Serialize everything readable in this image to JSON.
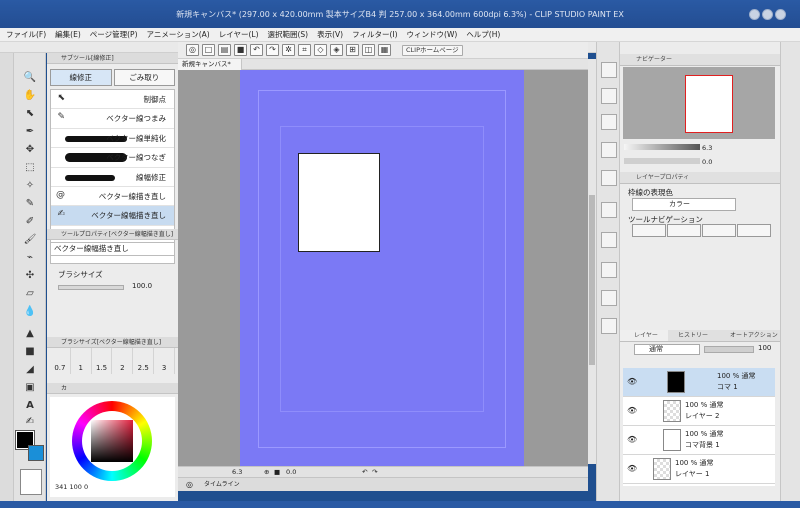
{
  "window": {
    "title": "新規キャンバス* (297.00 x 420.00mm 製本サイズB4 判 257.00 x 364.00mm 600dpi 6.3%) - CLIP STUDIO PAINT EX"
  },
  "menu": [
    "ファイル(F)",
    "編集(E)",
    "ページ管理(P)",
    "アニメーション(A)",
    "レイヤー(L)",
    "選択範囲(S)",
    "表示(V)",
    "フィルター(I)",
    "ウィンドウ(W)",
    "ヘルプ(H)"
  ],
  "toolbar": {
    "home_label": "CLIPホームページ"
  },
  "subtool": {
    "header": "サブツール[線修正]",
    "tabs": [
      "線修正",
      "ごみ取り"
    ],
    "items": [
      "制御点",
      "ベクター線つまみ",
      "ベクター線単純化",
      "ベクター線つなぎ",
      "線幅修正",
      "ベクター線描き直し",
      "ベクター線幅描き直し"
    ],
    "selected_index": 6
  },
  "tool_property": {
    "header": "ツールプロパティ[ベクター線幅描き直し]",
    "name": "ベクター線幅描き直し",
    "brush_size_label": "ブラシサイズ",
    "brush_size_value": "100.0"
  },
  "brush_size_panel": {
    "header": "ブラシサイズ[ベクター線幅描き直し]",
    "sizes": [
      "0.7",
      "1",
      "1.5",
      "2",
      "2.5",
      "3"
    ]
  },
  "color": {
    "header": "カ",
    "main_color": "#000000",
    "sub_color": "#1a8fd8",
    "readout": [
      "341",
      "100",
      "0"
    ]
  },
  "document": {
    "tab": "新規キャンバス*",
    "paper_color": "#7b79f5"
  },
  "status": {
    "zoom": "6.3",
    "angle": "0.0"
  },
  "timeline": {
    "label": "タイムライン"
  },
  "navigator": {
    "tab": "ナビゲーター",
    "zoom": "6.3",
    "angle": "0.0"
  },
  "layer_property": {
    "tab": "レイヤープロパティ",
    "effect_label": "枠線の表現色",
    "color_option": "カラー",
    "tool_nav_label": "ツールナビゲーション"
  },
  "layers": {
    "tabs": [
      "レイヤー",
      "ヒストリー",
      "オートアクション"
    ],
    "blend_mode": "通常",
    "opacity": "100",
    "items": [
      {
        "opacity": "100 %",
        "mode": "通常",
        "name": "コマ 1"
      },
      {
        "opacity": "100 %",
        "mode": "通常",
        "name": "レイヤー 2"
      },
      {
        "opacity": "100 %",
        "mode": "通常",
        "name": "コマ背景 1"
      },
      {
        "opacity": "100 %",
        "mode": "通常",
        "name": "レイヤー 1"
      }
    ],
    "selected_index": 0
  }
}
